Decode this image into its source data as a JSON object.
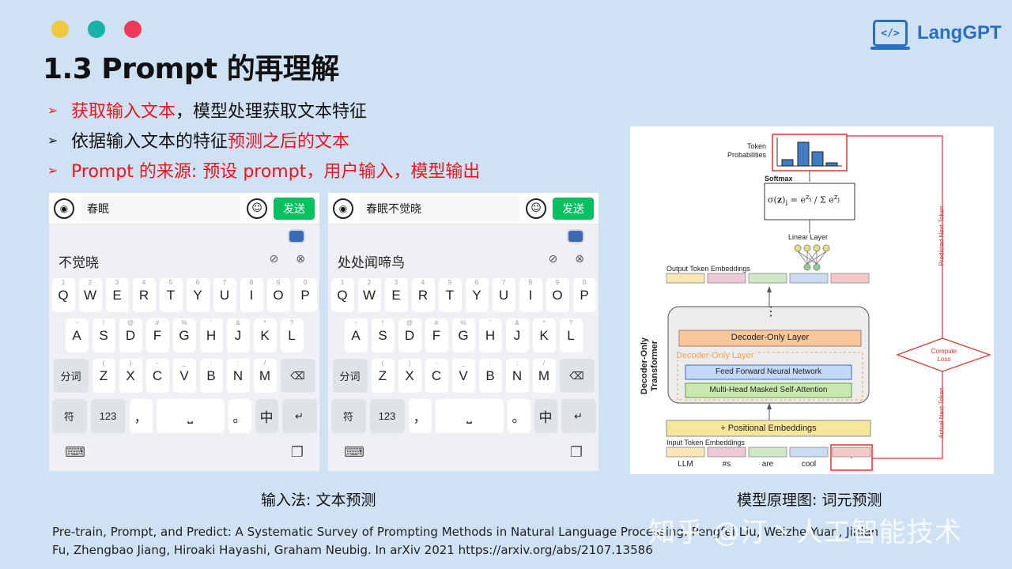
{
  "colors": {
    "dot1": "#efc83c",
    "dot2": "#17b3a6",
    "dot3": "#ee3a58",
    "accent": "#e8141e",
    "brand": "#2a6fc2"
  },
  "logo": {
    "text": "LangGPT",
    "icon": "code-laptop-icon"
  },
  "title": "1.3 Prompt 的再理解",
  "bullets": [
    {
      "red": "获取输入文本",
      "black": "，模型处理获取文本特征"
    },
    {
      "black": "依据输入文本的特征",
      "red": "预测之后的文本"
    },
    {
      "red": "Prompt 的来源: 预设 prompt，用户输入，模型输出"
    }
  ],
  "keyboard_left": {
    "input": "春眠",
    "candidate": "不觉晓",
    "send": "发送"
  },
  "keyboard_right": {
    "input": "春眠不觉晓",
    "candidate": "处处闻啼鸟",
    "send": "发送"
  },
  "keys": {
    "row1": [
      "Q",
      "W",
      "E",
      "R",
      "T",
      "Y",
      "U",
      "I",
      "O",
      "P"
    ],
    "row1_sub": [
      "1",
      "2",
      "3",
      "4",
      "5",
      "6",
      "7",
      "8",
      "9",
      "0"
    ],
    "row2": [
      "A",
      "S",
      "D",
      "F",
      "G",
      "H",
      "J",
      "K",
      "L"
    ],
    "row2_sub": [
      "~",
      "!",
      "@",
      "#",
      "%",
      "'",
      "&",
      "*",
      "?"
    ],
    "row3": [
      "Z",
      "X",
      "C",
      "V",
      "B",
      "N",
      "M"
    ],
    "row3_sub": [
      "(",
      ")",
      "-",
      "_",
      ":",
      ";",
      "/"
    ],
    "fenci": "分词",
    "fu": "符",
    "num": "123",
    "comma": "，",
    "period": "。",
    "zh": "中"
  },
  "captions": {
    "left": "输入法: 文本预测",
    "right": "模型原理图: 词元预测"
  },
  "diagram": {
    "token_probs": "Token Probabilities",
    "softmax": "Softmax",
    "linear": "Linear Layer",
    "output_emb": "Output Token Embeddings",
    "decoder_only_layer": "Decoder-Only Layer",
    "decoder_only_layer_orange": "Decoder-Only Layer",
    "ffn": "Feed Forward Neural Network",
    "mhsa": "Multi-Head Masked Self-Attention",
    "side_label": "Decoder-Only Transformer",
    "pos_emb": "+ Positional Embeddings",
    "input_emb": "Input Token Embeddings",
    "tokens": [
      "LLM",
      "#s",
      "are",
      "cool",
      "."
    ],
    "predicted": "Predicted Next Token",
    "actual": "Actual Next Token",
    "compute_loss": "Compute Loss",
    "dots": "⋮"
  },
  "reference": {
    "line1": "Pre-train, Prompt, and Predict: A Systematic Survey of Prompting Methods in Natural Language Processing. Pengfei Liu, Weizhe Yuan, Jinlan",
    "line2": "Fu, Zhengbao Jiang, Hiroaki Hayashi, Graham Neubig. In arXiv 2021 https://arxiv.org/abs/2107.13586"
  },
  "watermark": "知乎 @汀丶人工智能技术"
}
